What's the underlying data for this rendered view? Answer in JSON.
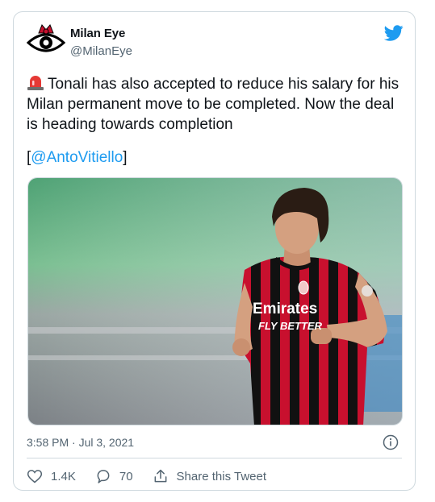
{
  "author": {
    "name": "Milan Eye",
    "handle": "@MilanEye"
  },
  "tweet": {
    "text": "Tonali has also accepted to reduce his salary for his Milan permanent move to be completed. Now the deal is heading towards completion",
    "mention_open": "[",
    "mention": "@AntoVitiello",
    "mention_close": "]"
  },
  "media": {
    "jersey_sponsor_line1": "Emirates",
    "jersey_sponsor_line2": "FLY BETTER"
  },
  "meta": {
    "timestamp": "3:58 PM · Jul 3, 2021"
  },
  "actions": {
    "likes": "1.4K",
    "replies": "70",
    "share_label": "Share this Tweet"
  },
  "colors": {
    "accent": "#1d9bf0",
    "secondary_text": "#536471",
    "border": "#cfd9de"
  }
}
